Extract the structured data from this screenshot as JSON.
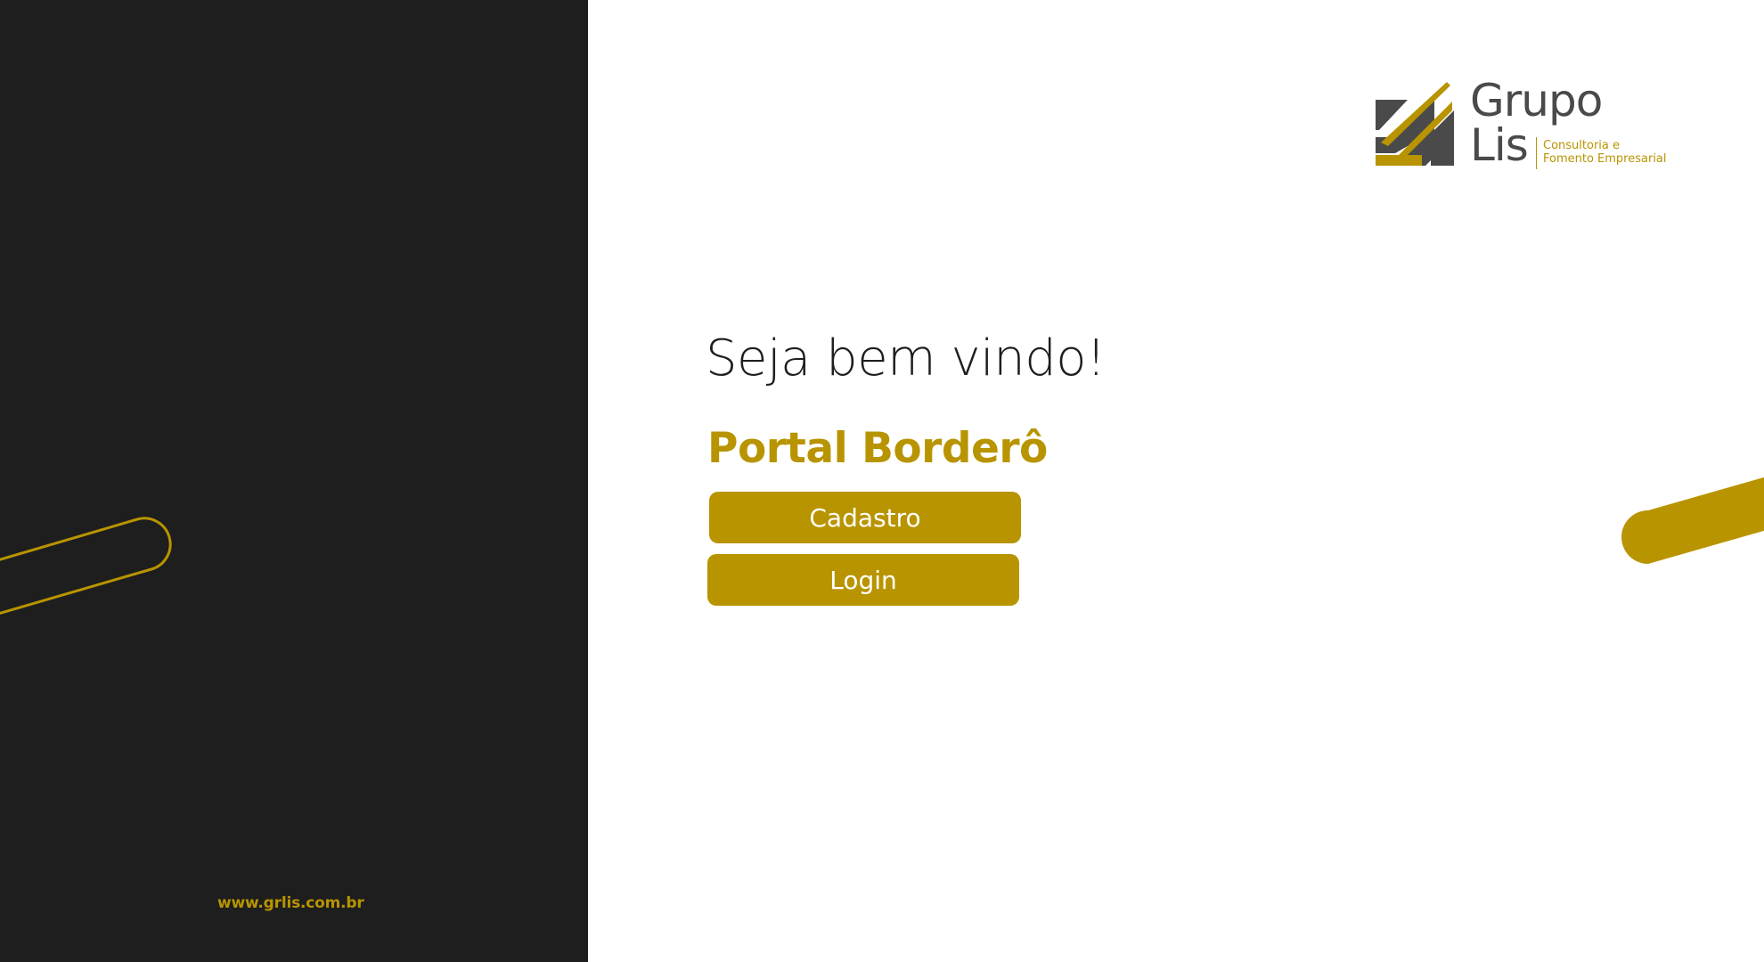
{
  "logo": {
    "name_line1": "Grupo",
    "name_line2": "Lis",
    "tagline_line1": "Consultoria e",
    "tagline_line2": "Fomento Empresarial"
  },
  "main": {
    "welcome": "Seja bem vindo!",
    "portal_title": "Portal Borderô",
    "cadastro_label": "Cadastro",
    "login_label": "Login"
  },
  "footer": {
    "site_link": "www.grlis.com.br"
  },
  "colors": {
    "accent": "#b89400",
    "dark_panel": "#1e1e1e",
    "logo_gray": "#4a4a4a",
    "background": "#ffffff"
  }
}
